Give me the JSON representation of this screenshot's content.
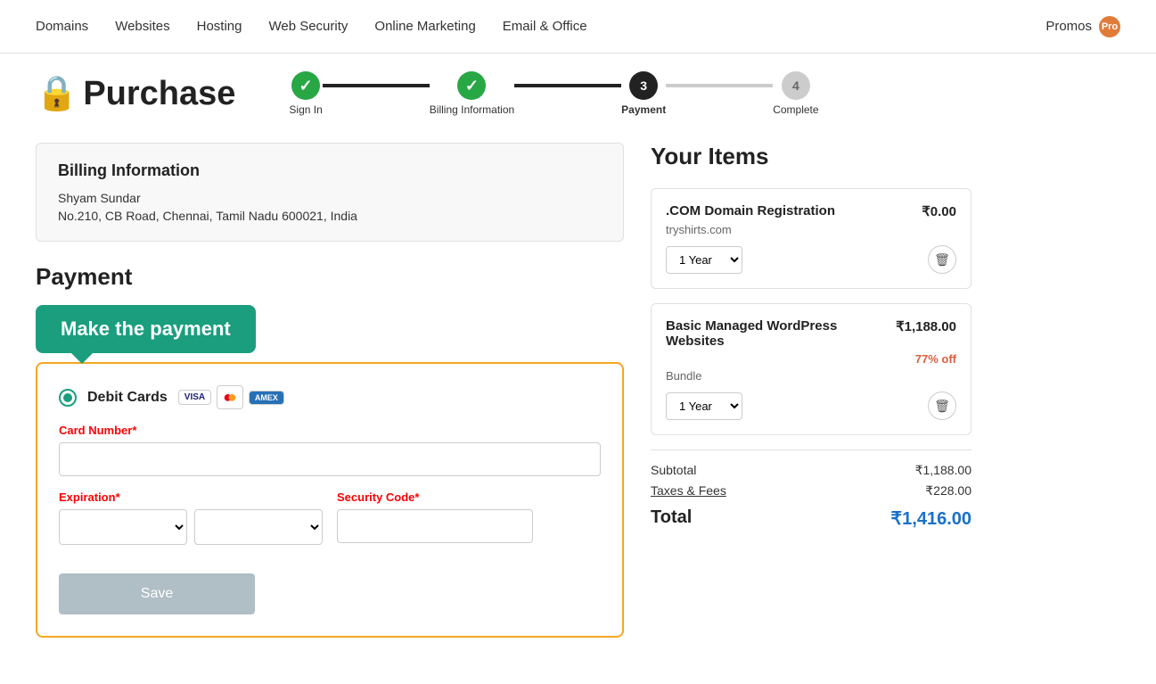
{
  "nav": {
    "links": [
      "Domains",
      "Websites",
      "Hosting",
      "Web Security",
      "Online Marketing",
      "Email & Office"
    ],
    "promos_label": "Promos",
    "pro_label": "Pro"
  },
  "purchase": {
    "title": "Purchase",
    "lock_icon": "🔒"
  },
  "progress": {
    "steps": [
      {
        "id": "sign-in",
        "label": "Sign In",
        "state": "completed",
        "number": "✓"
      },
      {
        "id": "billing-info",
        "label": "Billing Information",
        "state": "completed",
        "number": "✓"
      },
      {
        "id": "payment",
        "label": "Payment",
        "state": "active",
        "number": "3"
      },
      {
        "id": "complete",
        "label": "Complete",
        "state": "inactive",
        "number": "4"
      }
    ]
  },
  "billing": {
    "title": "Billing Information",
    "name": "Shyam Sundar",
    "address": "No.210, CB Road, Chennai, Tamil Nadu 600021, India"
  },
  "payment": {
    "title": "Payment",
    "tooltip": "Make the payment",
    "debit_label": "Debit Cards",
    "card_logos": [
      "VISA",
      "MC",
      "AMEX"
    ],
    "card_number_label": "Card Number",
    "card_number_required": "*",
    "card_number_placeholder": "",
    "expiration_label": "Expiration",
    "expiration_required": "*",
    "security_code_label": "Security Code",
    "security_code_required": "*",
    "security_placeholder": "",
    "save_label": "Save",
    "month_placeholder": "",
    "year_placeholder": ""
  },
  "your_items": {
    "title": "Your Items",
    "items": [
      {
        "name": ".COM Domain Registration",
        "subtitle": "tryshirts.com",
        "price": "₹0.00",
        "year": "1 Year",
        "discount": null
      },
      {
        "name": "Basic Managed WordPress Websites",
        "subtitle": "Bundle",
        "price": "₹1,188.00",
        "year": "1 Year",
        "discount": "77% off"
      }
    ],
    "subtotal_label": "Subtotal",
    "subtotal_value": "₹1,188.00",
    "taxes_label": "Taxes & Fees",
    "taxes_value": "₹228.00",
    "total_label": "Total",
    "total_value": "₹1,416.00"
  }
}
